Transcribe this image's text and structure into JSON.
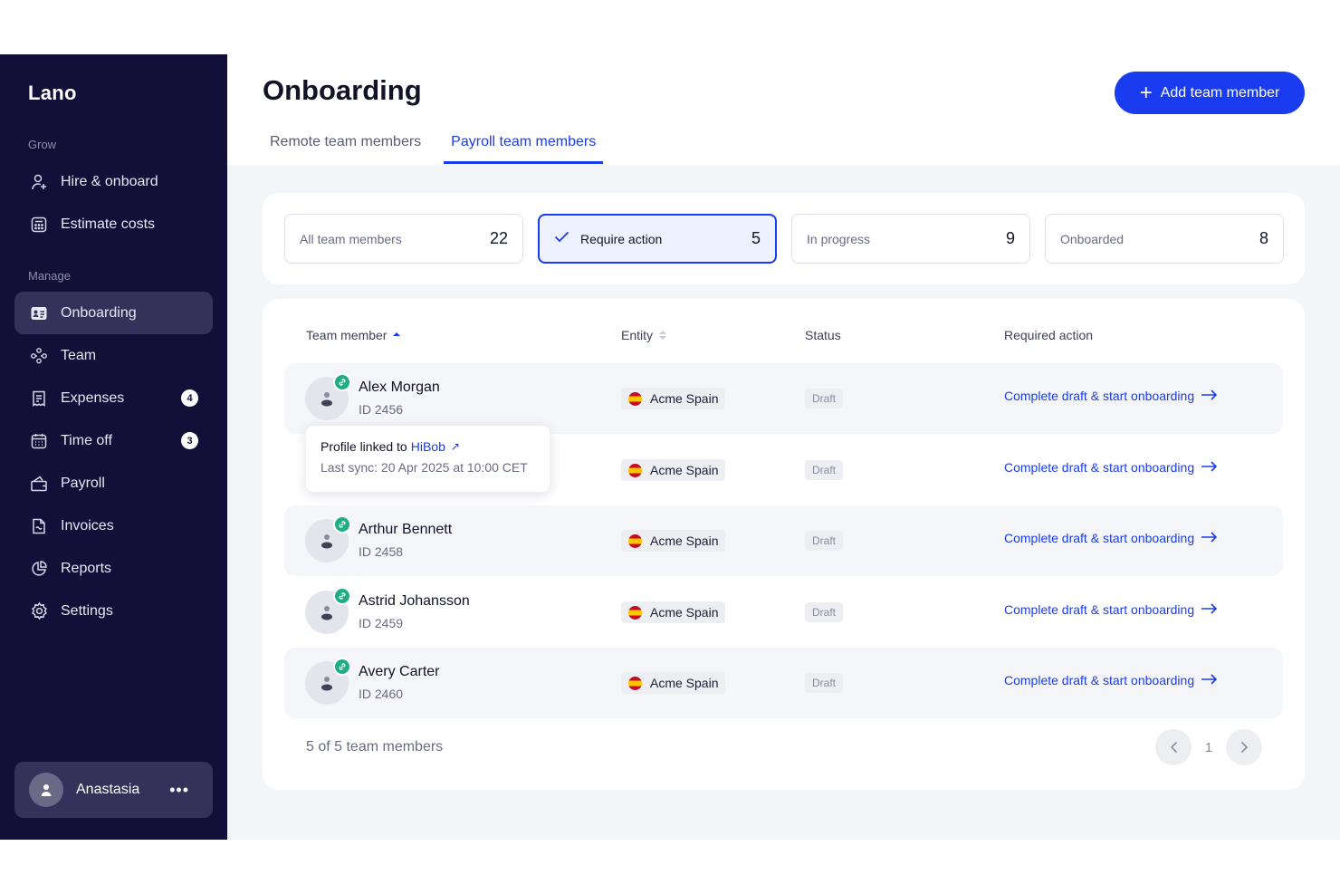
{
  "app": {
    "logo": "Lano"
  },
  "sidebar": {
    "grow_label": "Grow",
    "manage_label": "Manage",
    "grow_items": [
      {
        "label": "Hire & onboard",
        "icon": "person-plus-icon"
      },
      {
        "label": "Estimate costs",
        "icon": "calculator-icon"
      }
    ],
    "manage_items": [
      {
        "label": "Onboarding",
        "icon": "id-card-icon",
        "active": true
      },
      {
        "label": "Team",
        "icon": "team-icon"
      },
      {
        "label": "Expenses",
        "icon": "receipt-icon",
        "badge": "4"
      },
      {
        "label": "Time off",
        "icon": "calendar-icon",
        "badge": "3"
      },
      {
        "label": "Payroll",
        "icon": "wallet-icon"
      },
      {
        "label": "Invoices",
        "icon": "invoice-icon"
      },
      {
        "label": "Reports",
        "icon": "pie-chart-icon"
      },
      {
        "label": "Settings",
        "icon": "gear-icon"
      }
    ],
    "user": {
      "name": "Anastasia",
      "more": "•••"
    }
  },
  "header": {
    "title": "Onboarding",
    "add_button": "Add team member",
    "tabs": [
      {
        "label": "Remote team members",
        "active": false
      },
      {
        "label": "Payroll team members",
        "active": true
      }
    ]
  },
  "stats": [
    {
      "label": "All team members",
      "count": "22"
    },
    {
      "label": "Require action",
      "count": "5",
      "selected": true
    },
    {
      "label": "In progress",
      "count": "9"
    },
    {
      "label": "Onboarded",
      "count": "8"
    }
  ],
  "table": {
    "columns": [
      "Team member",
      "Entity",
      "Status",
      "Required action"
    ],
    "rows": [
      {
        "name": "Alex Morgan",
        "id": "ID 2456",
        "entity": "Acme Spain",
        "status": "Draft",
        "action": "Complete draft & start onboarding"
      },
      {
        "name": "",
        "id": "",
        "entity": "Acme Spain",
        "status": "Draft",
        "action": "Complete draft & start onboarding"
      },
      {
        "name": "Arthur Bennett",
        "id": "ID 2458",
        "entity": "Acme Spain",
        "status": "Draft",
        "action": "Complete draft & start onboarding"
      },
      {
        "name": "Astrid Johansson",
        "id": "ID 2459",
        "entity": "Acme Spain",
        "status": "Draft",
        "action": "Complete draft & start onboarding"
      },
      {
        "name": "Avery Carter",
        "id": "ID 2460",
        "entity": "Acme Spain",
        "status": "Draft",
        "action": "Complete draft & start onboarding"
      }
    ],
    "tooltip": {
      "prefix": "Profile linked to",
      "link": "HiBob",
      "ext_icon": "↗",
      "sync": "Last sync: 20 Apr 2025 at 10:00 CET"
    },
    "footer_count": "5 of 5 team members",
    "page": "1"
  },
  "colors": {
    "sidebar_bg": "#120f38",
    "accent": "#1a3cf0",
    "link_badge": "#1fae83"
  }
}
